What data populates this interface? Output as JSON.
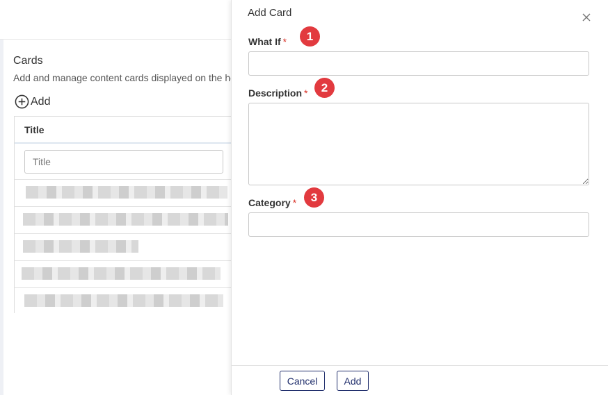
{
  "background": {
    "section_title": "Cards",
    "section_subtitle": "Add and manage content cards displayed on the home page.",
    "add_label": "Add",
    "table": {
      "column_header": "Title",
      "filter_placeholder": "Title"
    }
  },
  "drawer": {
    "title": "Add Card",
    "fields": {
      "what_if": {
        "label": "What If",
        "required_mark": "*",
        "value": ""
      },
      "description": {
        "label": "Description",
        "required_mark": "*",
        "value": ""
      },
      "category": {
        "label": "Category",
        "required_mark": "*",
        "value": ""
      }
    },
    "markers": [
      "1",
      "2",
      "3"
    ],
    "buttons": {
      "cancel": "Cancel",
      "add": "Add"
    }
  },
  "colors": {
    "accent": "#1f2d6b",
    "required": "#d93025",
    "marker": "#e23a3f"
  }
}
